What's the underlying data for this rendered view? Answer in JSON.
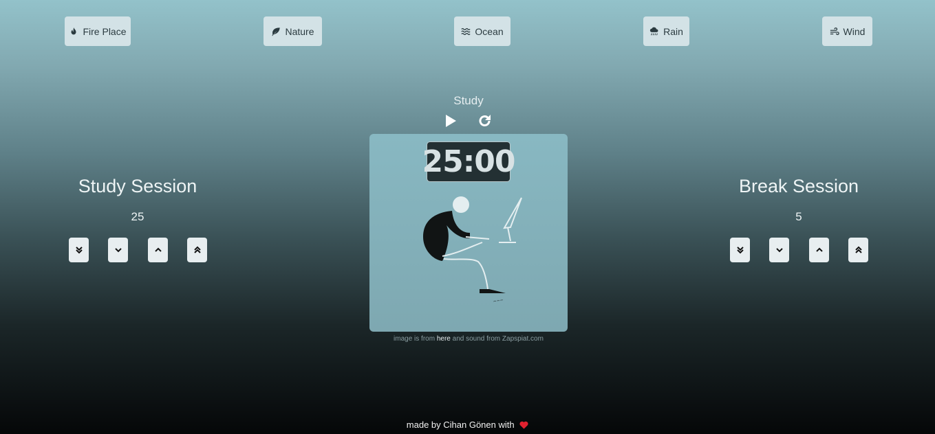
{
  "sounds": [
    {
      "label": "Fire Place",
      "icon": "fire-icon"
    },
    {
      "label": "Nature",
      "icon": "leaf-icon"
    },
    {
      "label": "Ocean",
      "icon": "water-icon"
    },
    {
      "label": "Rain",
      "icon": "cloud-rain-icon"
    },
    {
      "label": "Wind",
      "icon": "wind-icon"
    }
  ],
  "timer": {
    "mode": "Study",
    "time": "25:00",
    "play_icon": "play-icon",
    "reset_icon": "redo-icon"
  },
  "credit": {
    "prefix": "image is from",
    "link": "here",
    "suffix": "and sound from Zapspiat.com"
  },
  "study": {
    "title": "Study Session",
    "value": "25"
  },
  "break": {
    "title": "Break Session",
    "value": "5"
  },
  "footer": {
    "text": "made by Cihan Gönen with",
    "heart_color": "#e0212f"
  }
}
